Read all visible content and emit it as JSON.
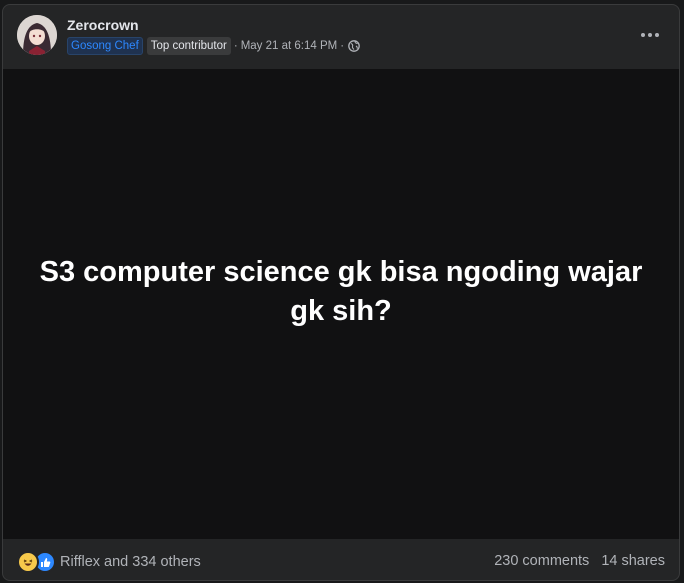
{
  "post": {
    "author": "Zerocrown",
    "badges": [
      "Gosong Chef",
      "Top contributor"
    ],
    "separator": "·",
    "timestamp": "May 21 at 6:14 PM",
    "privacy_icon": "globe-icon",
    "more_icon": "more-options-icon",
    "text": "S3 computer science gk bisa ngoding wajar gk sih?"
  },
  "footer": {
    "reaction_icons": [
      "haha-reaction-icon",
      "like-reaction-icon"
    ],
    "reactions_label": "Rifflex and 334 others",
    "comments_label": "230 comments",
    "shares_label": "14 shares"
  },
  "colors": {
    "card_bg": "#242526",
    "body_bg": "#111112",
    "accent_blue": "#2d88ff",
    "text_secondary": "#b0b3b8"
  }
}
